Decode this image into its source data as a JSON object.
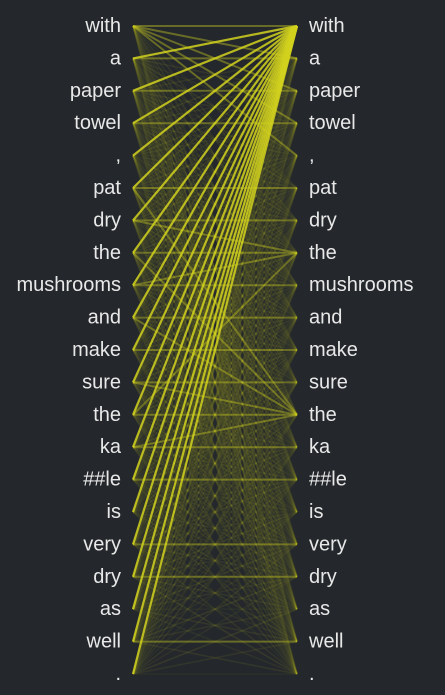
{
  "colors": {
    "background": "#24282c",
    "text": "#e8e8e8",
    "attention": "#d2d21e"
  },
  "tokens": {
    "left": [
      "with",
      "a",
      "paper",
      "towel",
      ",",
      "pat",
      "dry",
      "the",
      "mushrooms",
      "and",
      "make",
      "sure",
      "the",
      "ka",
      "##le",
      "is",
      "very",
      "dry",
      "as",
      "well",
      "."
    ],
    "right": [
      "with",
      "a",
      "paper",
      "towel",
      ",",
      "pat",
      "dry",
      "the",
      "mushrooms",
      "and",
      "make",
      "sure",
      "the",
      "ka",
      "##le",
      "is",
      "very",
      "dry",
      "as",
      "well",
      "."
    ]
  },
  "attention": {
    "strong": [
      [
        1,
        0
      ],
      [
        2,
        0
      ],
      [
        3,
        0
      ],
      [
        4,
        0
      ],
      [
        5,
        0
      ],
      [
        6,
        0
      ],
      [
        7,
        0
      ],
      [
        8,
        0
      ],
      [
        9,
        0
      ],
      [
        10,
        0
      ],
      [
        11,
        0
      ],
      [
        12,
        0
      ],
      [
        13,
        0
      ],
      [
        14,
        0
      ],
      [
        15,
        0
      ],
      [
        16,
        0
      ],
      [
        17,
        0
      ],
      [
        18,
        0
      ],
      [
        19,
        0
      ],
      [
        20,
        0
      ]
    ],
    "medium": [
      [
        0,
        0
      ],
      [
        0,
        1
      ],
      [
        0,
        2
      ],
      [
        0,
        3
      ],
      [
        0,
        4
      ],
      [
        1,
        1
      ],
      [
        2,
        2
      ],
      [
        3,
        3
      ],
      [
        5,
        5
      ],
      [
        6,
        6
      ],
      [
        7,
        7
      ],
      [
        8,
        8
      ],
      [
        9,
        9
      ],
      [
        10,
        10
      ],
      [
        11,
        11
      ],
      [
        12,
        12
      ],
      [
        13,
        13
      ],
      [
        14,
        14
      ],
      [
        16,
        16
      ],
      [
        17,
        17
      ],
      [
        19,
        19
      ],
      [
        7,
        12
      ],
      [
        12,
        7
      ],
      [
        6,
        7
      ],
      [
        8,
        7
      ],
      [
        11,
        12
      ],
      [
        13,
        12
      ],
      [
        5,
        12
      ],
      [
        9,
        12
      ]
    ],
    "faint_default": 0.08
  }
}
